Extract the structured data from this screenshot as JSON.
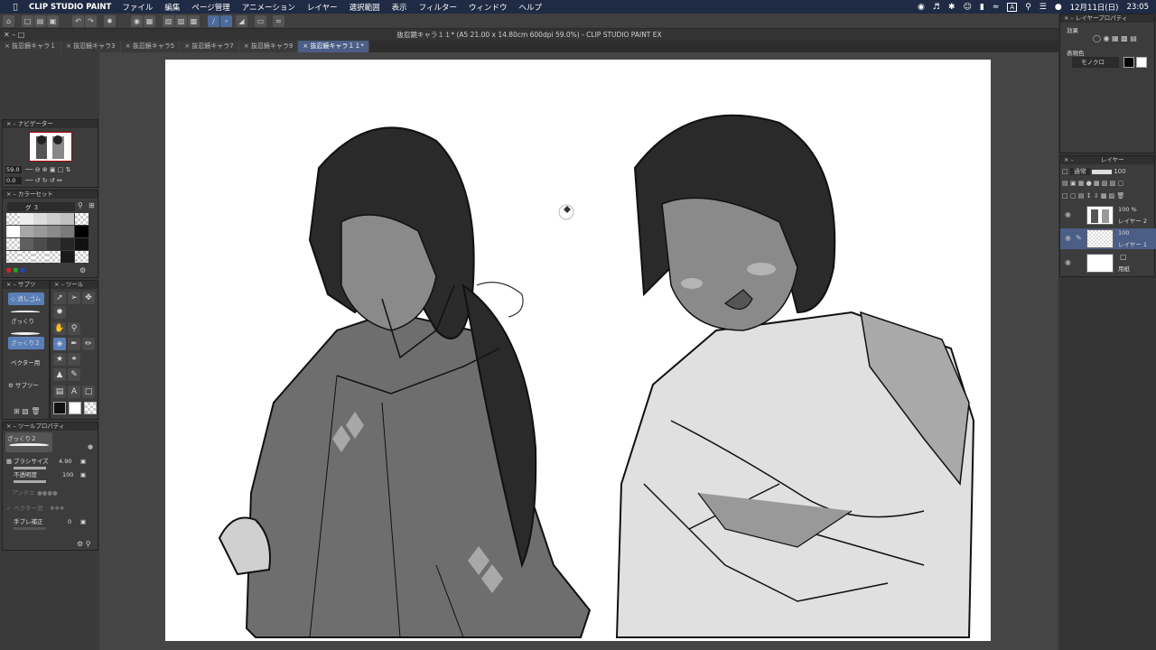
{
  "menubar": {
    "app": "CLIP STUDIO PAINT",
    "items": [
      "ファイル",
      "編集",
      "ページ管理",
      "アニメーション",
      "レイヤー",
      "選択範囲",
      "表示",
      "フィルター",
      "ウィンドウ",
      "ヘルプ"
    ],
    "input_mode": "A",
    "date": "12月11日(日)",
    "time": "23:05"
  },
  "window": {
    "title": "抜忍鏡キャラ１１* (A5 21.00 x 14.80cm 600dpi 59.0%) - CLIP STUDIO PAINT EX"
  },
  "tabs": [
    "抜忍鏡キャラ１",
    "抜忍鏡キャラ3",
    "抜忍鏡キャラ5",
    "抜忍鏡キャラ7",
    "抜忍鏡キャラ9",
    "抜忍鏡キャラ１１*"
  ],
  "navigator": {
    "title": "ナビゲーター",
    "zoom": "59.0",
    "rotate": "0.0"
  },
  "colorset": {
    "title": "カラーセット",
    "set_name": "グ ３"
  },
  "subtool": {
    "title": "サブツ",
    "group": "消しゴム",
    "items": [
      "ざっくり",
      "ざっくり２",
      "ベクター用"
    ],
    "extra": "サブツー"
  },
  "tools": {
    "title": "ツール"
  },
  "toolprop": {
    "title": "ツールプロパティ",
    "brush_name": "ざっくり２",
    "brush_size_label": "ブラシサイズ",
    "brush_size": "4.90",
    "opacity_label": "不透明度",
    "opacity": "100",
    "aa_label": "アンチエ",
    "vector_label": "ベクター消",
    "stabilize_label": "手ブレ補正",
    "stabilize": "0"
  },
  "layerprop": {
    "title": "レイヤープロパティ",
    "effect_label": "効果",
    "expression_label": "表現色",
    "expression_value": "モノクロ"
  },
  "layers": {
    "title": "レイヤー",
    "blend": "通常",
    "opacity": "100",
    "items": [
      {
        "pct": "100 %",
        "name": "レイヤー 2"
      },
      {
        "pct": "100",
        "name": "レイヤー 1"
      },
      {
        "pct": "",
        "name": "用紙"
      }
    ]
  },
  "colors": {
    "menubar": "#1f2a44",
    "accent": "#5a7fb8",
    "canvas": "#ffffff"
  }
}
